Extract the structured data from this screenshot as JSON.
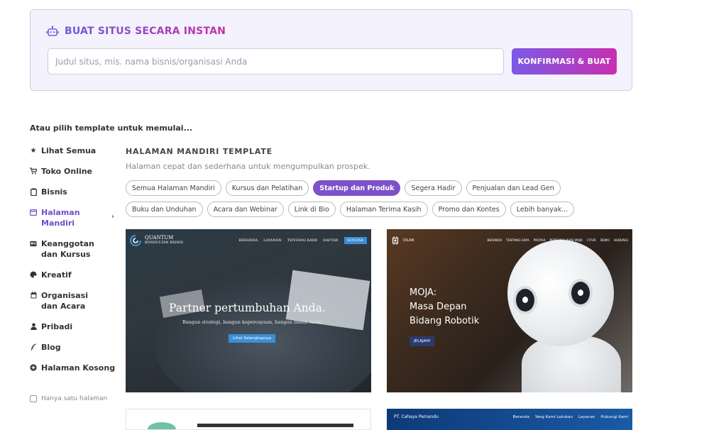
{
  "builder": {
    "title": "BUAT SITUS SECARA INSTAN",
    "input_placeholder": "Judul situs, mis. nama bisnis/organisasi Anda",
    "input_value": "",
    "confirm_label": "KONFIRMASI & BUAT",
    "icon": "robot-icon"
  },
  "or_pick": "Atau pilih template untuk memulai...",
  "sidebar": {
    "items": [
      {
        "label": "Lihat Semua",
        "icon": "star-icon"
      },
      {
        "label": "Toko Online",
        "icon": "cart-icon"
      },
      {
        "label": "Bisnis",
        "icon": "clipboard-icon"
      },
      {
        "label": "Halaman Mandiri",
        "icon": "window-icon"
      },
      {
        "label": "Keanggotan dan Kursus",
        "icon": "id-card-icon"
      },
      {
        "label": "Kreatif",
        "icon": "palette-icon"
      },
      {
        "label": "Organisasi dan Acara",
        "icon": "calendar-icon"
      },
      {
        "label": "Pribadi",
        "icon": "user-icon"
      },
      {
        "label": "Blog",
        "icon": "feather-icon"
      },
      {
        "label": "Halaman Kosong",
        "icon": "plus-circle-icon"
      }
    ],
    "single_page_label": "Hanya satu halaman"
  },
  "section": {
    "title": "HALAMAN MANDIRI TEMPLATE",
    "subtitle": "Halaman cepat dan sederhana untuk mengumpulkan prospek.",
    "chips": [
      "Semua Halaman Mandiri",
      "Kursus dan Pelatihan",
      "Startup dan Produk",
      "Segera Hadir",
      "Penjualan dan Lead Gen",
      "Buku dan Unduhan",
      "Acara dan Webinar",
      "Link di Bio",
      "Halaman Terima Kasih",
      "Promo dan Kontes",
      "Lebih banyak..."
    ],
    "active_chip": "Startup dan Produk"
  },
  "templates": {
    "quantum": {
      "logo_line1": "QUANTUM",
      "logo_line2": "KONSULTAN BISNIS",
      "nav": [
        "BERANDA",
        "LAYANAN",
        "TENTANG KAMI",
        "DAFTAR"
      ],
      "cta": "KONTAK",
      "hero": "Partner pertumbuhan Anda.",
      "sub": "Bangun strategi, bangun kepercayaan, bangun bisnis Anda.",
      "button": "Lihat Selengkapnya"
    },
    "moja": {
      "logo": "DILAN",
      "nav": [
        "BERANDA",
        "TENTANG SAYA",
        "PROYEK",
        "PERSONALISASI MOJA",
        "FITUR",
        "DEMO",
        "HUBUNGI"
      ],
      "title_line1": "MOJA:",
      "title_line2": "Masa Depan",
      "title_line3": "Bidang Robotik",
      "button": "JELAJAHI"
    },
    "cahaya": {
      "logo": "PT. Cahaya Pemandu",
      "nav": [
        "Beranda",
        "Yang Kami Lakukan",
        "Layanan",
        "Hubungi Kami"
      ]
    }
  },
  "colors": {
    "accent": "#7d52c9",
    "gradient_start": "#7b5ae6",
    "gradient_end": "#c92fb0"
  }
}
